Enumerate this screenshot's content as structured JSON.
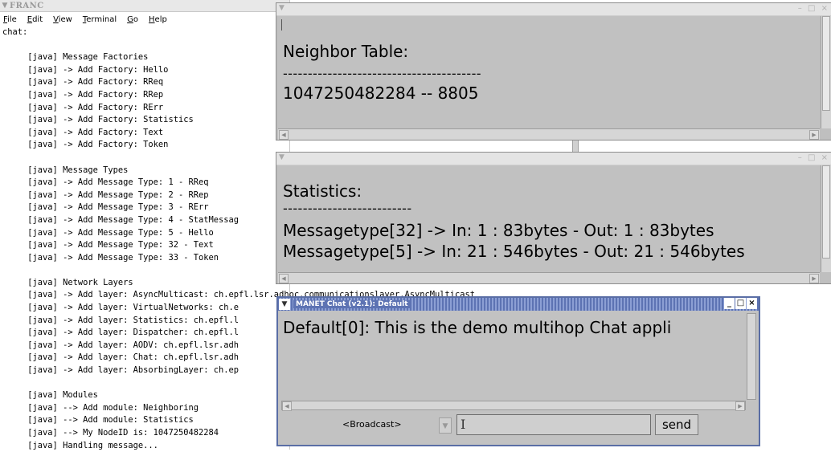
{
  "terminal": {
    "title": "FRANC",
    "menu": [
      "File",
      "Edit",
      "View",
      "Terminal",
      "Go",
      "Help"
    ],
    "lines": [
      "chat:",
      "",
      "     [java] Message Factories",
      "     [java] -> Add Factory: Hello",
      "     [java] -> Add Factory: RReq",
      "     [java] -> Add Factory: RRep",
      "     [java] -> Add Factory: RErr",
      "     [java] -> Add Factory: Statistics",
      "     [java] -> Add Factory: Text",
      "     [java] -> Add Factory: Token",
      "",
      "     [java] Message Types",
      "     [java] -> Add Message Type: 1 - RReq",
      "     [java] -> Add Message Type: 2 - RRep",
      "     [java] -> Add Message Type: 3 - RErr",
      "     [java] -> Add Message Type: 4 - StatMessag",
      "     [java] -> Add Message Type: 5 - Hello",
      "     [java] -> Add Message Type: 32 - Text",
      "     [java] -> Add Message Type: 33 - Token",
      "",
      "     [java] Network Layers",
      "     [java] -> Add layer: AsyncMulticast: ch.epfl.lsr.adhoc.communicationslayer.AsyncMulticast",
      "     [java] -> Add layer: VirtualNetworks: ch.e",
      "     [java] -> Add layer: Statistics: ch.epfl.l",
      "     [java] -> Add layer: Dispatcher: ch.epfl.l",
      "     [java] -> Add layer: AODV: ch.epfl.lsr.adh",
      "     [java] -> Add layer: Chat: ch.epfl.lsr.adh",
      "     [java] -> Add layer: AbsorbingLayer: ch.ep",
      "",
      "     [java] Modules",
      "     [java] --> Add module: Neighboring",
      "     [java] --> Add module: Statistics",
      "     [java] --> My NodeID is: 1047250482284",
      "     [java] Handling message..."
    ]
  },
  "neighbor": {
    "heading": "Neighbor Table:",
    "separator": "----------------------------------------",
    "entry": "1047250482284 -- 8805"
  },
  "stats": {
    "heading": "Statistics:",
    "separator": "--------------------------",
    "rows": [
      "Messagetype[32] -> In: 1 : 83bytes - Out: 1 : 83bytes",
      "Messagetype[5] -> In: 21 : 546bytes - Out: 21 : 546bytes"
    ]
  },
  "chat": {
    "title": "MANET Chat (v2.1): Default",
    "message": "Default[0]: This is the demo multihop Chat appli",
    "recipient": "<Broadcast>",
    "input_value": "I",
    "send_label": "send"
  },
  "icons": {
    "window_menu": "chevron-down-icon",
    "minimize": "minimize-icon",
    "maximize": "maximize-icon",
    "close": "close-icon"
  }
}
